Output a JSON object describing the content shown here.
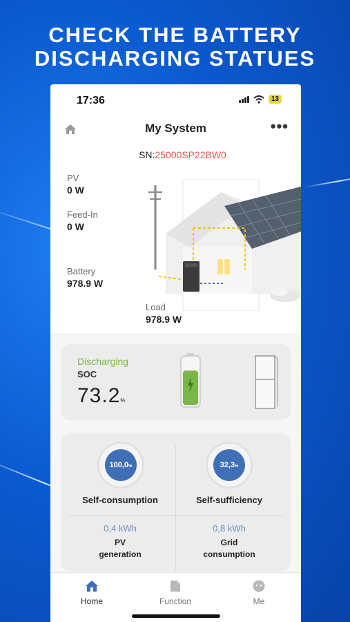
{
  "promo": {
    "line1": "CHECK THE BATTERY",
    "line2": "DISCHARGING STATUES"
  },
  "status_bar": {
    "time": "17:36",
    "battery": "13",
    "icons": [
      "signal-icon",
      "wifi-icon",
      "battery-icon"
    ]
  },
  "header": {
    "title": "My System",
    "left_icon": "home-icon",
    "right_icon": "more-icon",
    "more_label": "•••"
  },
  "serial": {
    "prefix": "SN:",
    "value": "25000SP22BW0"
  },
  "overview": {
    "pv": {
      "label": "PV",
      "value": "0 W"
    },
    "feed_in": {
      "label": "Feed-In",
      "value": "0 W"
    },
    "battery": {
      "label": "Battery",
      "value": "978.9 W"
    },
    "load": {
      "label": "Load",
      "value": "978.9 W"
    }
  },
  "soc_card": {
    "state": "Discharging",
    "label": "SOC",
    "value": "73.2",
    "unit": "%",
    "level": 0.732,
    "state_color": "#7ab648"
  },
  "stats": {
    "self_consumption": {
      "value": "100,0",
      "unit": "%",
      "label": "Self-consumption"
    },
    "self_sufficiency": {
      "value": "32,3",
      "unit": "%",
      "label": "Self-sufficiency"
    },
    "pv_generation": {
      "value": "0,4 kWh",
      "label_line1": "PV",
      "label_line2": "generation"
    },
    "grid_consumption": {
      "value": "0,8 kWh",
      "label_line1": "Grid",
      "label_line2": "consumption"
    }
  },
  "tabbar": {
    "tabs": [
      {
        "label": "Home",
        "icon": "home-icon",
        "active": true
      },
      {
        "label": "Function",
        "icon": "function-icon",
        "active": false
      },
      {
        "label": "Me",
        "icon": "profile-icon",
        "active": false
      }
    ]
  },
  "colors": {
    "accent_blue": "#3f6fb6",
    "serial_red": "#e2574c",
    "discharge_green": "#7ab648",
    "background_blue": "#0a55c9"
  }
}
